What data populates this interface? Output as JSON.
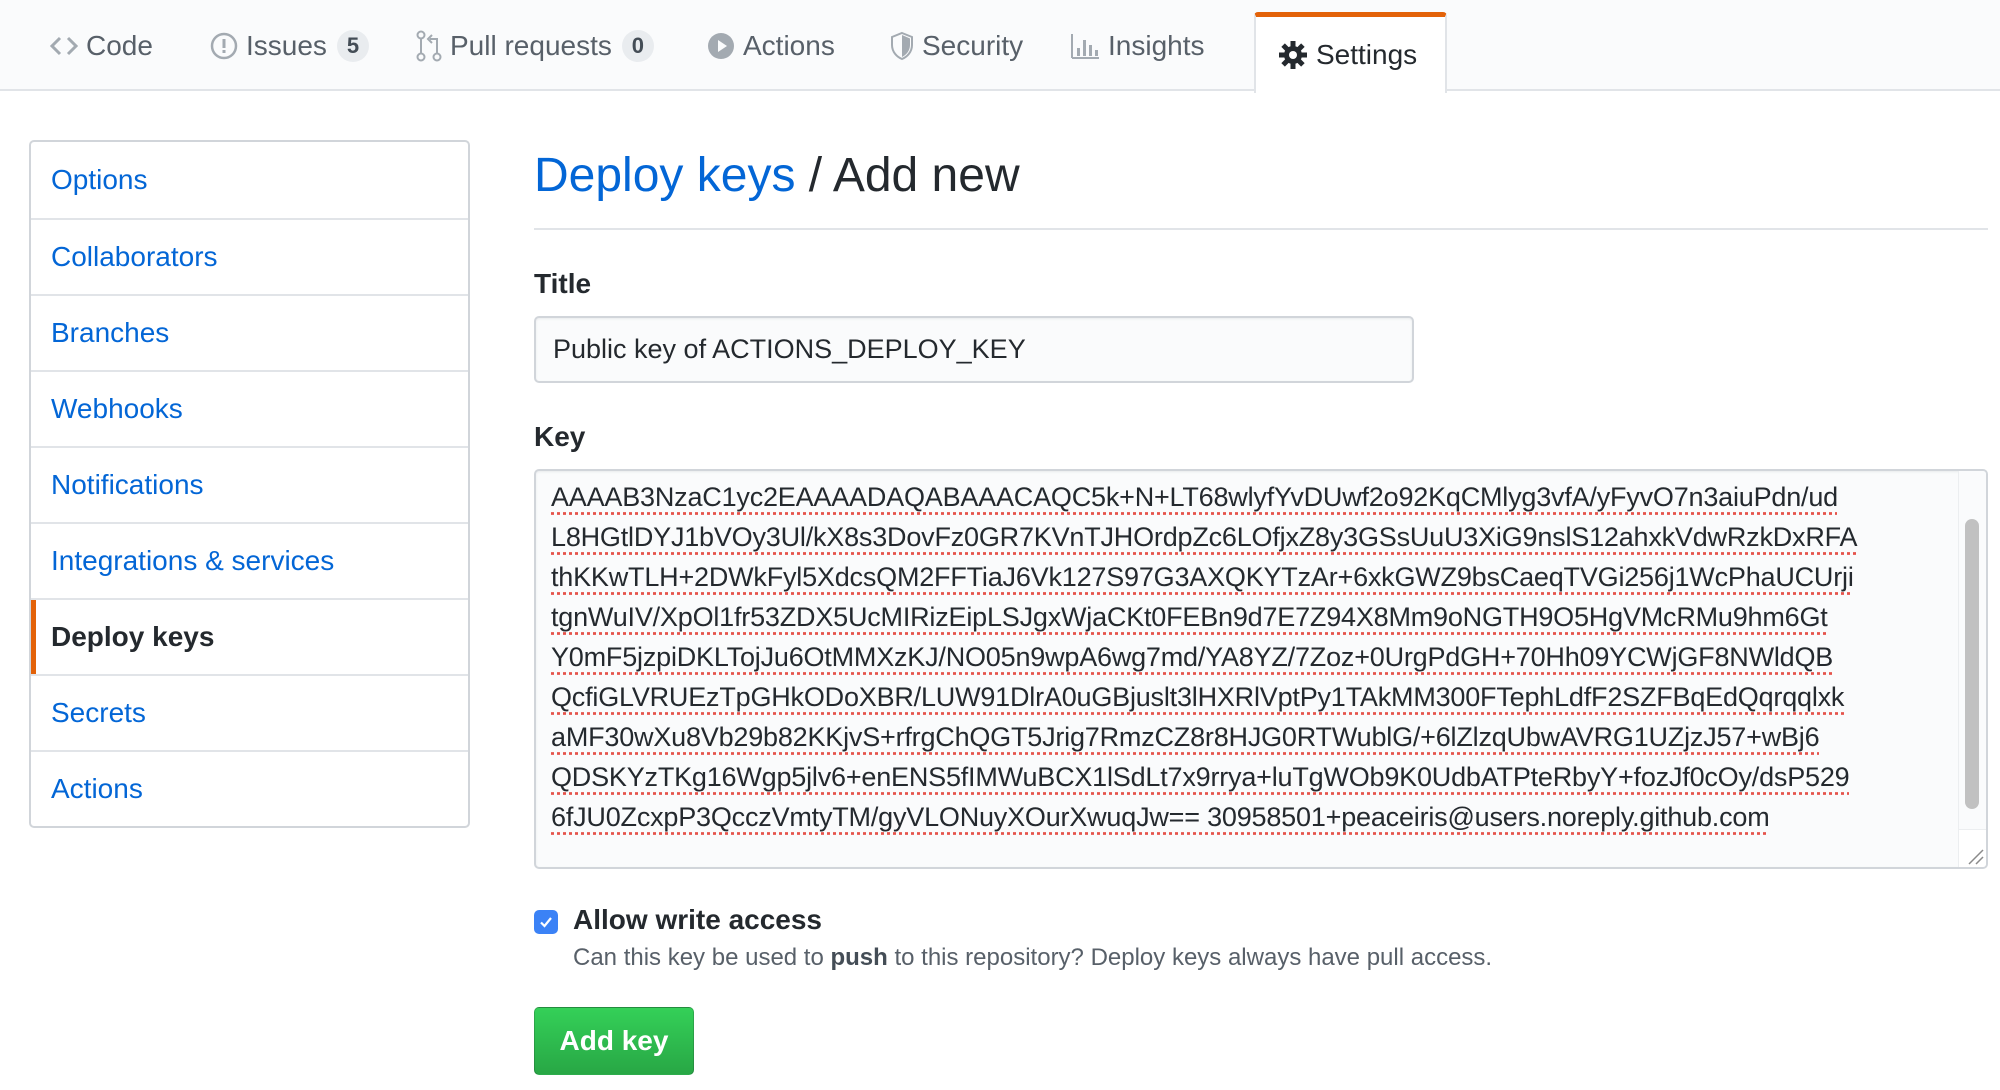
{
  "tabs": [
    {
      "label": "Code",
      "icon": "code-icon"
    },
    {
      "label": "Issues",
      "icon": "issue-icon",
      "count": "5"
    },
    {
      "label": "Pull requests",
      "icon": "pull-request-icon",
      "count": "0"
    },
    {
      "label": "Actions",
      "icon": "play-icon"
    },
    {
      "label": "Security",
      "icon": "shield-icon"
    },
    {
      "label": "Insights",
      "icon": "graph-icon"
    },
    {
      "label": "Settings",
      "icon": "gear-icon",
      "selected": true
    }
  ],
  "sidebar": {
    "items": [
      {
        "label": "Options"
      },
      {
        "label": "Collaborators"
      },
      {
        "label": "Branches"
      },
      {
        "label": "Webhooks"
      },
      {
        "label": "Notifications"
      },
      {
        "label": "Integrations & services"
      },
      {
        "label": "Deploy keys",
        "active": true
      },
      {
        "label": "Secrets"
      },
      {
        "label": "Actions"
      }
    ]
  },
  "main": {
    "breadcrumb_link": "Deploy keys",
    "breadcrumb_separator": " / ",
    "heading": "Add new",
    "title_label": "Title",
    "title_value": "Public key of ACTIONS_DEPLOY_KEY",
    "key_label": "Key",
    "key_lines": [
      "AAAAB3NzaC1yc2EAAAADAQABAAACAQC5k+N+LT68wlyfYvDUwf2o92KqCMlyg3vfA/yFyvO7n3aiuPdn/ud",
      "L8HGtlDYJ1bVOy3Ul/kX8s3DovFz0GR7KVnTJHOrdpZc6LOfjxZ8y3GSsUuU3XiG9nslS12ahxkVdwRzkDxRFA",
      "thKKwTLH+2DWkFyl5XdcsQM2FFTiaJ6Vk127S97G3AXQKYTzAr+6xkGWZ9bsCaeqTVGi256j1WcPhaUCUrji",
      "tgnWuIV/XpOl1fr53ZDX5UcMIRizEipLSJgxWjaCKt0FEBn9d7E7Z94X8Mm9oNGTH9O5HgVMcRMu9hm6Gt",
      "Y0mF5jzpiDKLTojJu6OtMMXzKJ/NO05n9wpA6wg7md/YA8YZ/7Zoz+0UrgPdGH+70Hh09YCWjGF8NWldQB",
      "QcfiGLVRUEzTpGHkODoXBR/LUW91DlrA0uGBjuslt3lHXRlVptPy1TAkMM300FTephLdfF2SZFBqEdQqrqqlxk",
      "aMF30wXu8Vb29b82KKjvS+rfrgChQGT5Jrig7RmzCZ8r8HJG0RTWublG/+6lZlzqUbwAVRG1UZjzJ57+wBj6",
      "QDSKYzTKg16Wgp5jlv6+enENS5fIMWuBCX1lSdLt7x9rrya+luTgWOb9K0UdbATPteRbyY+fozJf0cOy/dsP529",
      "6fJU0ZcxpP3QcczVmtyTM/gyVLONuyXOurXwuqJw== 30958501+peaceiris@users.noreply.github.com"
    ],
    "allow_write_label": "Allow write access",
    "allow_write_checked": true,
    "note_prefix": "Can this key be used to ",
    "note_bold": "push",
    "note_suffix": " to this repository? Deploy keys always have pull access.",
    "submit_label": "Add key"
  },
  "colors": {
    "accent_orange": "#e36209",
    "link_blue": "#0366d6",
    "button_green": "#28a745",
    "checkbox_blue": "#3b82f6"
  }
}
